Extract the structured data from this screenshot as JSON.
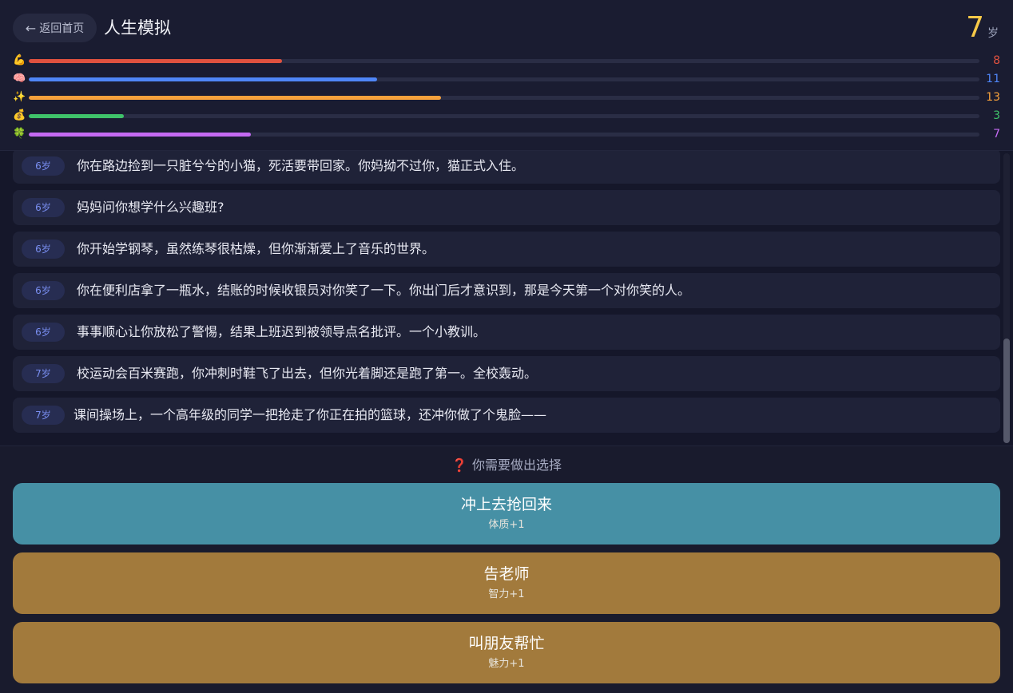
{
  "header": {
    "back_label": "返回首页",
    "back_icon": "arrow-left-icon",
    "title": "人生模拟",
    "age_value": "7",
    "age_unit": "岁"
  },
  "stats": [
    {
      "icon": "💪",
      "icon_name": "muscle-icon",
      "value": 8,
      "max": 30,
      "color": "#e0513f"
    },
    {
      "icon": "🧠",
      "icon_name": "brain-icon",
      "value": 11,
      "max": 30,
      "color": "#4f86f7"
    },
    {
      "icon": "✨",
      "icon_name": "sparkles-icon",
      "value": 13,
      "max": 30,
      "color": "#f6a13c"
    },
    {
      "icon": "💰",
      "icon_name": "money-bag-icon",
      "value": 3,
      "max": 30,
      "color": "#3fc36a"
    },
    {
      "icon": "🍀",
      "icon_name": "clover-icon",
      "value": 7,
      "max": 30,
      "color": "#c46af2"
    }
  ],
  "log": [
    {
      "age": "6岁",
      "text": "你在路边捡到一只脏兮兮的小猫，死活要带回家。你妈拗不过你，猫正式入住。"
    },
    {
      "age": "6岁",
      "text": "妈妈问你想学什么兴趣班?"
    },
    {
      "age": "6岁",
      "text": "你开始学钢琴，虽然练琴很枯燥，但你渐渐爱上了音乐的世界。"
    },
    {
      "age": "6岁",
      "text": "你在便利店拿了一瓶水，结账的时候收银员对你笑了一下。你出门后才意识到，那是今天第一个对你笑的人。"
    },
    {
      "age": "6岁",
      "text": "事事顺心让你放松了警惕，结果上班迟到被领导点名批评。一个小教训。"
    },
    {
      "age": "7岁",
      "text": "校运动会百米赛跑，你冲刺时鞋飞了出去，但你光着脚还是跑了第一。全校轰动。"
    },
    {
      "age": "7岁",
      "text": "课间操场上，一个高年级的同学一把抢走了你正在拍的篮球，还冲你做了个鬼脸——"
    }
  ],
  "choice": {
    "prompt_icon": "❓",
    "prompt": "你需要做出选择",
    "options": [
      {
        "title": "冲上去抢回来",
        "effect": "体质+1",
        "color": "#4690a5"
      },
      {
        "title": "告老师",
        "effect": "智力+1",
        "color": "#a27a3c"
      },
      {
        "title": "叫朋友帮忙",
        "effect": "魅力+1",
        "color": "#a27a3c"
      }
    ]
  }
}
